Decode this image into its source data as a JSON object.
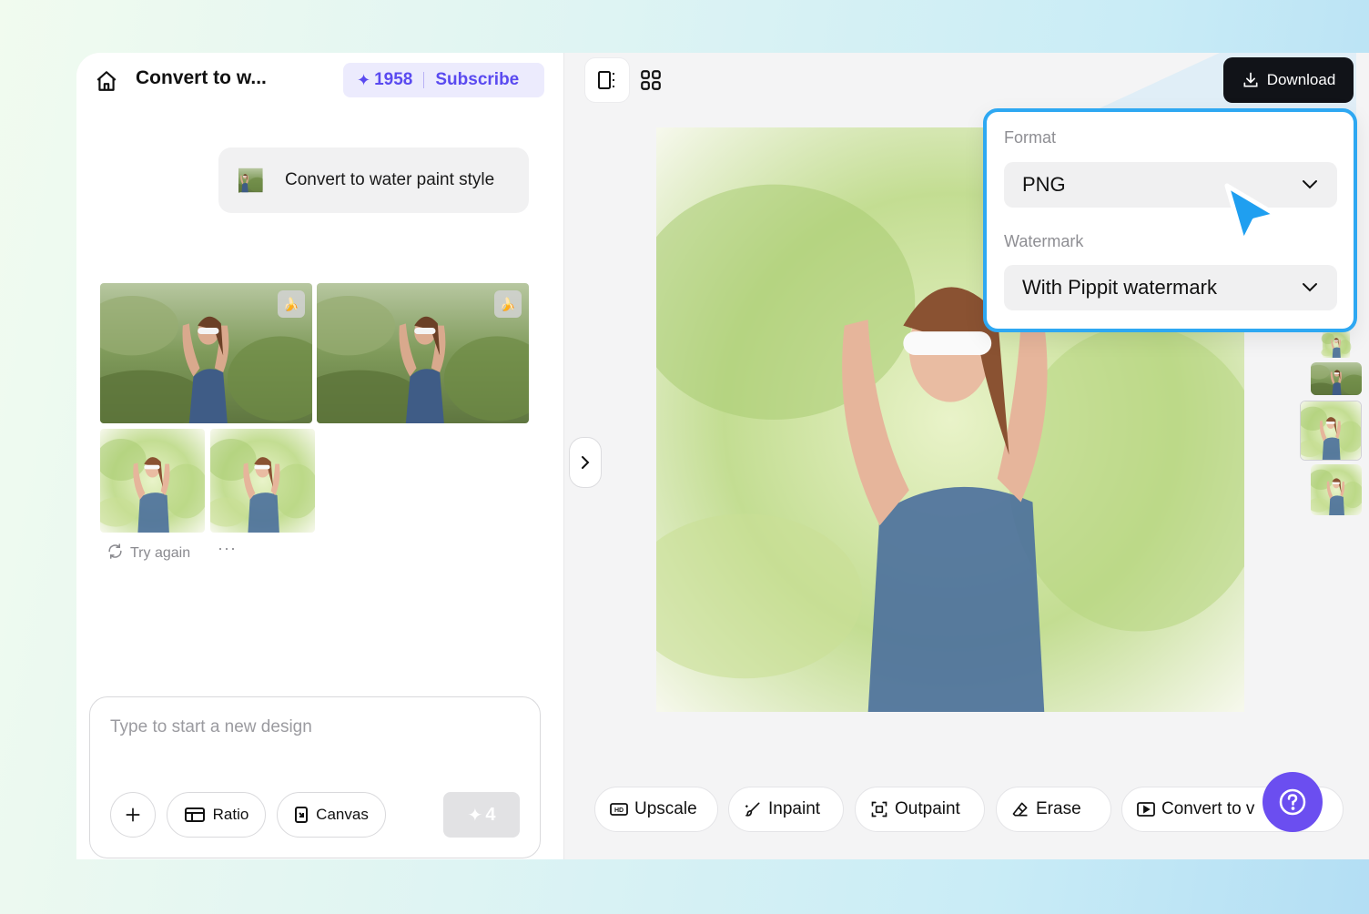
{
  "header": {
    "title": "Convert to w...",
    "credits": "1958",
    "subscribe_label": "Subscribe"
  },
  "prompt": {
    "text": "Convert to water paint style"
  },
  "results": {
    "try_again_label": "Try again",
    "more_label": "···"
  },
  "composer": {
    "placeholder": "Type to start a new design",
    "ratio_label": "Ratio",
    "canvas_label": "Canvas",
    "send_cost": "4"
  },
  "download": {
    "button_label": "Download",
    "format_label": "Format",
    "format_value": "PNG",
    "watermark_label": "Watermark",
    "watermark_value": "With Pippit watermark"
  },
  "tools": [
    {
      "label": "Upscale",
      "icon": "hd-icon"
    },
    {
      "label": "Inpaint",
      "icon": "brush-icon"
    },
    {
      "label": "Outpaint",
      "icon": "expand-frame-icon"
    },
    {
      "label": "Erase",
      "icon": "eraser-icon"
    },
    {
      "label": "Convert to v",
      "icon": "video-icon"
    }
  ],
  "colors": {
    "accent": "#5a4af0",
    "help_button": "#6b4ef0",
    "download_button": "#111318",
    "callout_border": "#2ea8f2"
  }
}
